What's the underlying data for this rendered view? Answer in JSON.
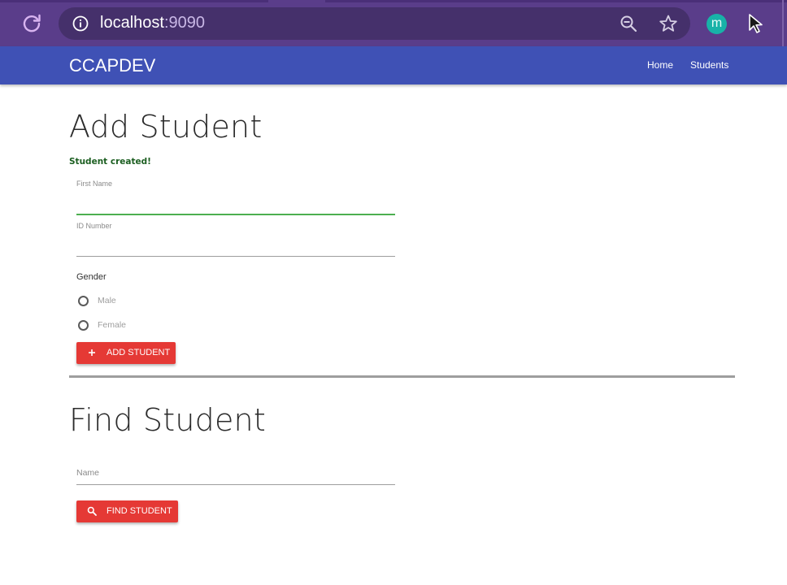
{
  "browser": {
    "url_host": "localhost",
    "url_port": ":9090",
    "profile_initial": "m"
  },
  "nav": {
    "brand": "CCAPDEV",
    "links": [
      "Home",
      "Students"
    ]
  },
  "add_student": {
    "title": "Add Student",
    "success_message": "Student created!",
    "first_name_label": "First Name",
    "first_name_value": "",
    "id_number_label": "ID Number",
    "id_number_value": "",
    "gender_label": "Gender",
    "gender_options": [
      "Male",
      "Female"
    ],
    "submit_label": "ADD STUDENT"
  },
  "find_student": {
    "title": "Find Student",
    "name_placeholder": "Name",
    "submit_label": "FIND STUDENT"
  },
  "colors": {
    "browser_frame": "#5a3d8a",
    "navbar": "#3f51b5",
    "button": "#e53935",
    "success": "#1b5e20",
    "active_input": "#4caf50"
  },
  "icons": {
    "reload": "reload-icon",
    "site_info": "info-icon",
    "zoom": "zoom-out-icon",
    "bookmark": "star-icon",
    "extension": "cursor-icon",
    "add": "plus-icon",
    "search": "search-icon"
  }
}
